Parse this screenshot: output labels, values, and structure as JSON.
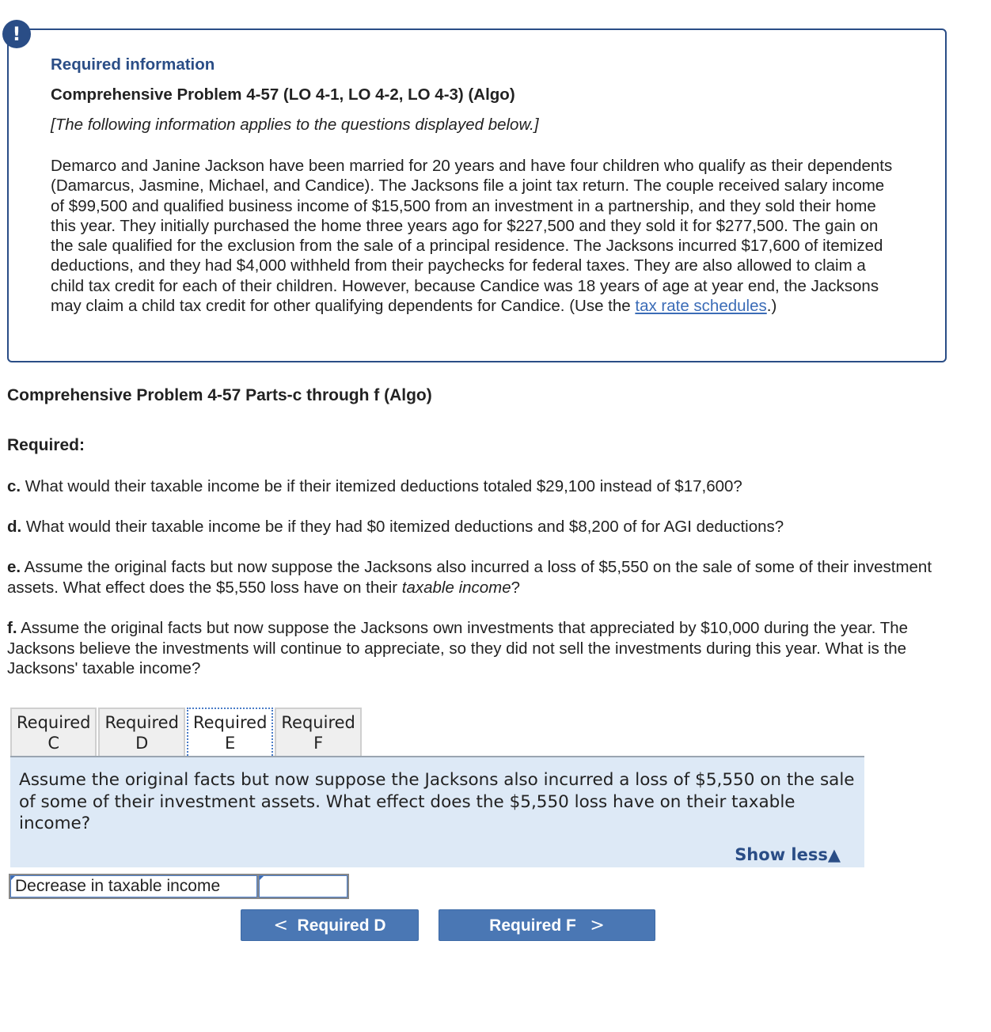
{
  "info_box": {
    "alert_icon": "!",
    "required_info_title": "Required information",
    "problem_title": "Comprehensive Problem 4-57 (LO 4-1, LO 4-2, LO 4-3) (Algo)",
    "applies_note": "[The following information applies to the questions displayed below.]",
    "scenario_text": "Demarco and Janine Jackson have been married for 20 years and have four children who qualify as their dependents (Damarcus, Jasmine, Michael, and Candice). The Jacksons file a joint tax return. The couple received salary income of $99,500 and qualified business income of $15,500 from an investment in a partnership, and they sold their home this year. They initially purchased the home three years ago for $227,500 and they sold it for $277,500. The gain on the sale qualified for the exclusion from the sale of a principal residence. The Jacksons incurred $17,600 of itemized deductions, and they had $4,000 withheld from their paychecks for federal taxes. They are also allowed to claim a child tax credit for each of their children. However, because Candice was 18 years of age at year end, the Jacksons may claim a child tax credit for other qualifying dependents for Candice. (Use the ",
    "link_text": "tax rate schedules",
    "scenario_end": ".)"
  },
  "parts_title": "Comprehensive Problem 4-57 Parts-c through f (Algo)",
  "required_label": "Required:",
  "questions": [
    {
      "letter": "c.",
      "text": " What would their taxable income be if their itemized deductions totaled $29,100 instead of $17,600?"
    },
    {
      "letter": "d.",
      "text": " What would their taxable income be if they had $0 itemized deductions and $8,200 of for AGI deductions?"
    },
    {
      "letter": "e.",
      "text": " Assume the original facts but now suppose the Jacksons also incurred a loss of $5,550 on the sale of some of their investment assets. What effect does the $5,550 loss have on their ",
      "italic": "taxable income",
      "end": "?"
    },
    {
      "letter": "f.",
      "text": " Assume the original facts but now suppose the Jacksons own investments that appreciated by $10,000 during the year. The Jacksons believe the investments will continue to appreciate, so they did not sell the investments during this year. What is the Jacksons' taxable income?"
    }
  ],
  "tabs": [
    {
      "line1": "Required",
      "line2": "C",
      "active": false
    },
    {
      "line1": "Required",
      "line2": "D",
      "active": false
    },
    {
      "line1": "Required",
      "line2": "E",
      "active": true
    },
    {
      "line1": "Required",
      "line2": "F",
      "active": false
    }
  ],
  "panel": {
    "question": "Assume the original facts but now suppose the Jacksons also incurred a loss of $5,550 on the sale of some of their investment assets. What effect does the $5,550 loss have on their taxable income?",
    "show_less": "Show less",
    "show_less_icon": "▲"
  },
  "answer": {
    "label": "Decrease in taxable income",
    "value": ""
  },
  "nav": {
    "prev_label": "Required D",
    "prev_icon": "<",
    "next_label": "Required F",
    "next_icon": ">"
  },
  "colors": {
    "brand_blue": "#2a4d86",
    "link_blue": "#3b6cb7",
    "button_blue": "#4a77b4",
    "panel_bg": "#dde9f6"
  }
}
